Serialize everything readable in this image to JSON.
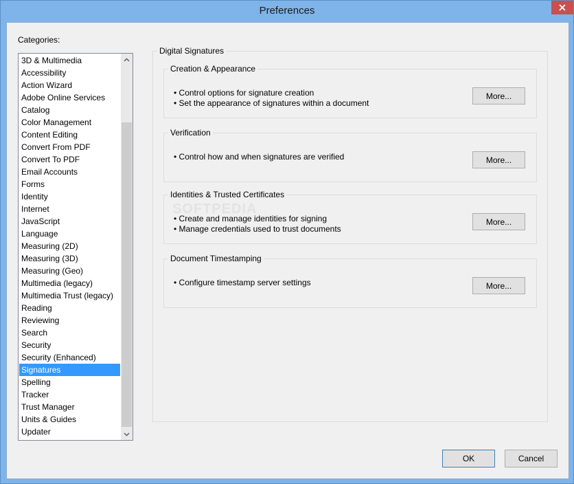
{
  "window": {
    "title": "Preferences",
    "close_label": "✕"
  },
  "categories": {
    "label": "Categories:",
    "items": [
      "3D & Multimedia",
      "Accessibility",
      "Action Wizard",
      "Adobe Online Services",
      "Catalog",
      "Color Management",
      "Content Editing",
      "Convert From PDF",
      "Convert To PDF",
      "Email Accounts",
      "Forms",
      "Identity",
      "Internet",
      "JavaScript",
      "Language",
      "Measuring (2D)",
      "Measuring (3D)",
      "Measuring (Geo)",
      "Multimedia (legacy)",
      "Multimedia Trust (legacy)",
      "Reading",
      "Reviewing",
      "Search",
      "Security",
      "Security (Enhanced)",
      "Signatures",
      "Spelling",
      "Tracker",
      "Trust Manager",
      "Units & Guides",
      "Updater"
    ],
    "selected": "Signatures"
  },
  "panel": {
    "title": "Digital Signatures",
    "groups": [
      {
        "title": "Creation & Appearance",
        "bullets": [
          "• Control options for signature creation",
          "• Set the appearance of signatures within a document"
        ],
        "button": "More..."
      },
      {
        "title": "Verification",
        "bullets": [
          "• Control how and when signatures are verified"
        ],
        "button": "More..."
      },
      {
        "title": "Identities & Trusted Certificates",
        "bullets": [
          "• Create and manage identities for signing",
          "• Manage credentials used to trust documents"
        ],
        "button": "More..."
      },
      {
        "title": "Document Timestamping",
        "bullets": [
          "• Configure timestamp server settings"
        ],
        "button": "More..."
      }
    ]
  },
  "watermark": "SOFTPEDIA",
  "footer": {
    "ok": "OK",
    "cancel": "Cancel"
  },
  "colors": {
    "titlebar": "#7eb4ea",
    "close": "#c75050",
    "selection": "#3399ff"
  },
  "icons": {
    "close": "close-icon",
    "scroll_up": "chevron-up-icon",
    "scroll_down": "chevron-down-icon"
  }
}
